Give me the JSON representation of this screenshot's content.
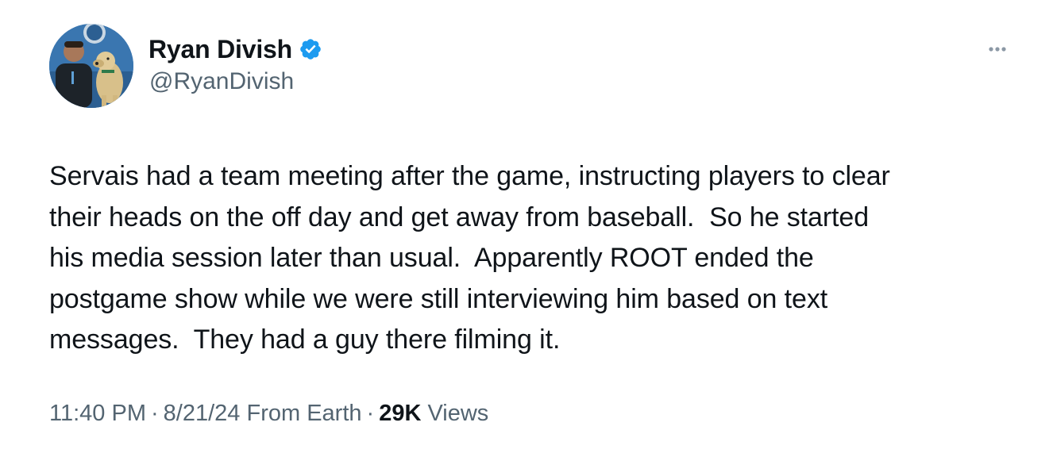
{
  "author": {
    "name": "Ryan Divish",
    "handle": "@RyanDivish",
    "verified": true,
    "verified_color": "#1d9bf0"
  },
  "tweet": {
    "text": "Servais had a team meeting after the game, instructing players to clear\ntheir heads on the off day and get away from baseball.  So he started\nhis media session later than usual.  Apparently ROOT ended the\npostgame show while we were still interviewing him based on text\nmessages.  They had a guy there filming it."
  },
  "meta": {
    "time": "11:40 PM",
    "separator": "·",
    "date": "8/21/24",
    "source": "From Earth",
    "views_count": "29K",
    "views_label": "Views"
  },
  "icons": {
    "more": "more-horizontal-icon",
    "verified": "verified-badge-icon"
  }
}
